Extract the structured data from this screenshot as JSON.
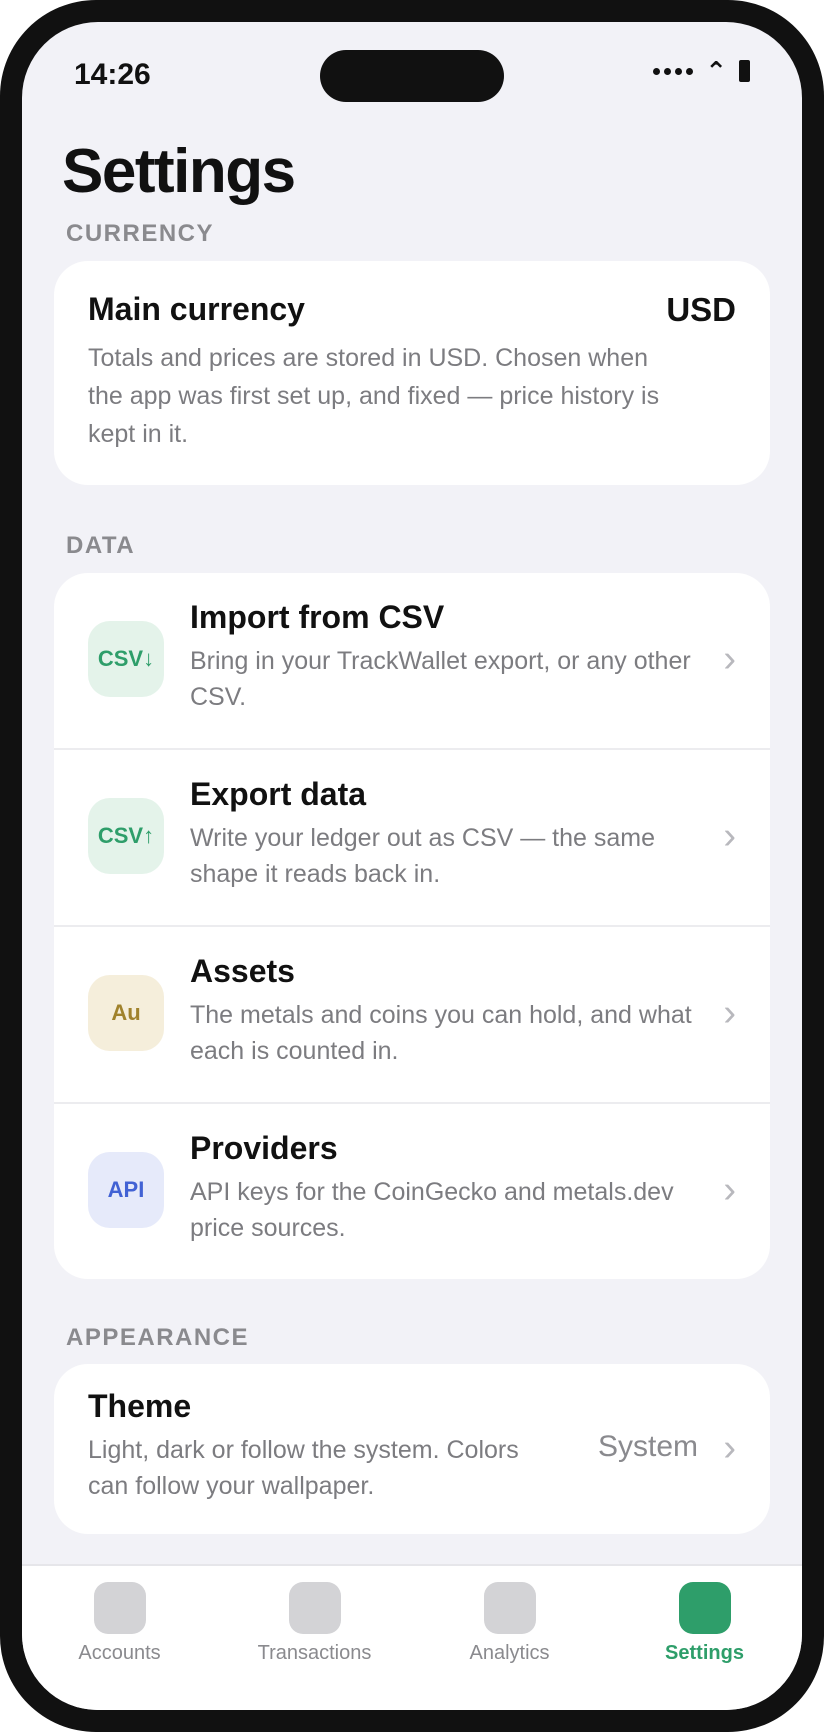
{
  "status_bar": {
    "time": "14:26"
  },
  "page": {
    "title": "Settings"
  },
  "sections": {
    "currency": {
      "label": "CURRENCY",
      "title": "Main currency",
      "value": "USD",
      "description": "Totals and prices are stored in USD. Chosen when the app was first set up, and fixed — price history is kept in it."
    },
    "data": {
      "label": "DATA",
      "items": [
        {
          "icon": "CSV↓",
          "icon_name": "csv-import-icon",
          "title": "Import from CSV",
          "description": "Bring in your TrackWallet export, or any other CSV."
        },
        {
          "icon": "CSV↑",
          "icon_name": "csv-export-icon",
          "title": "Export data",
          "description": "Write your ledger out as CSV — the same shape it reads back in."
        },
        {
          "icon": "Au",
          "icon_name": "gold-asset-icon",
          "title": "Assets",
          "description": "The metals and coins you can hold, and what each is counted in."
        },
        {
          "icon": "API",
          "icon_name": "api-icon",
          "title": "Providers",
          "description": "API keys for the CoinGecko and metals.dev price sources."
        }
      ]
    },
    "appearance": {
      "label": "APPEARANCE",
      "title": "Theme",
      "description": "Light, dark or follow the system. Colors can follow your wallpaper.",
      "value": "System"
    }
  },
  "chevron": "›",
  "tabbar": {
    "tabs": [
      {
        "label": "Accounts",
        "active": false
      },
      {
        "label": "Transactions",
        "active": false
      },
      {
        "label": "Analytics",
        "active": false
      },
      {
        "label": "Settings",
        "active": true
      }
    ]
  },
  "colors": {
    "accent": "#2e9e6a",
    "background": "#f2f2f7",
    "card": "#ffffff",
    "secondary_text": "#7c7c80"
  }
}
